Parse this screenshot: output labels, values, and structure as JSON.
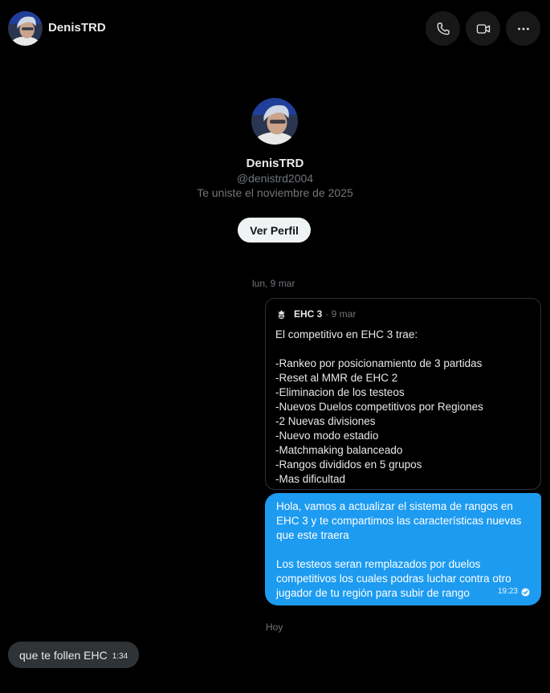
{
  "header": {
    "name": "DenisTRD",
    "call_icon": "phone-icon",
    "video_icon": "video-camera-icon",
    "more_icon": "more-horizontal-icon"
  },
  "profile": {
    "name": "DenisTRD",
    "handle": "@denistrd2004",
    "joined": "Te uniste el noviembre de 2025",
    "view_profile_label": "Ver Perfil"
  },
  "conversation": {
    "date_1": "lun, 9 mar",
    "date_2": "Hoy",
    "quote": {
      "author": "EHC 3",
      "meta": "· 9 mar",
      "lines": [
        "El competitivo en EHC 3 trae:",
        "",
        "-Rankeo por posicionamiento de 3 partidas",
        "-Reset al MMR de EHC 2",
        "-Eliminacion de los testeos",
        "-Nuevos Duelos competitivos por Regiones",
        "-2 Nuevas divisiones",
        "-Nuevo modo estadio",
        "-Matchmaking balanceado",
        "-Rangos divididos en 5 grupos",
        "-Mas dificultad"
      ]
    },
    "sent_message": {
      "lines": [
        "Hola, vamos a actualizar el sistema de rangos en",
        "EHC 3 y te compartimos las características nuevas",
        "que este traera",
        "",
        "Los testeos seran remplazados por duelos",
        "competitivos los cuales podras luchar contra otro",
        "jugador de tu región para subir de rango"
      ],
      "time": "19:23",
      "status_icon": "sent-check-icon"
    },
    "received_message": {
      "text": "que te follen EHC",
      "time": "1:34"
    }
  },
  "colors": {
    "background": "#000000",
    "accent": "#1d9bf0",
    "received_bubble": "#2f3336",
    "muted_text": "#71767b"
  }
}
